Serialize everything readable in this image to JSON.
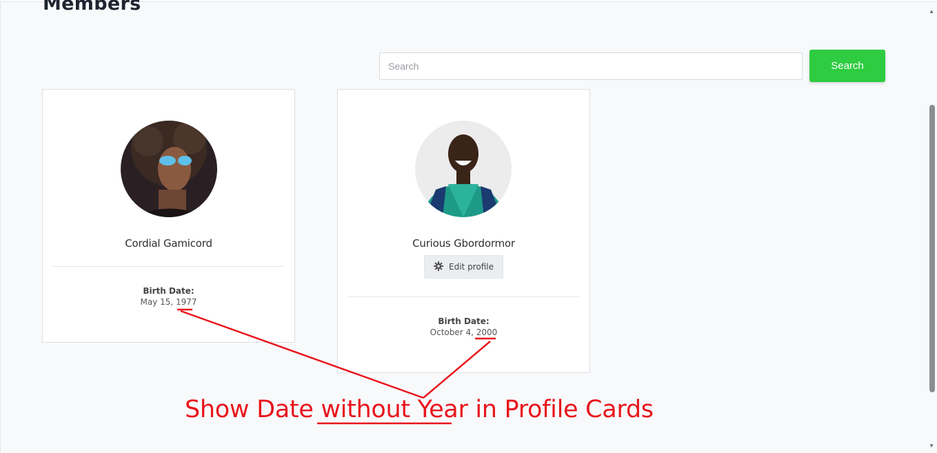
{
  "page": {
    "title": "Members"
  },
  "search": {
    "placeholder": "Search",
    "value": "",
    "button_label": "Search"
  },
  "members": [
    {
      "name": "Cordial Gamicord",
      "birth_label": "Birth Date:",
      "birth_date": "May 15, 1977",
      "avatar": "member-photo-sunglasses"
    },
    {
      "name": "Curious Gbordormor",
      "birth_label": "Birth Date:",
      "birth_date": "October 4, 2000",
      "edit_label": "Edit profile",
      "avatar": "member-photo-green-jersey"
    }
  ],
  "annotation": {
    "text": "Show Date without Year in Profile Cards",
    "color": "#e8141c"
  },
  "colors": {
    "accent": "#2ecc40",
    "background": "#f8f9fb"
  },
  "icons": {
    "edit": "gear-icon",
    "scroll_up": "chevron-up-icon",
    "scroll_down": "chevron-down-icon"
  }
}
